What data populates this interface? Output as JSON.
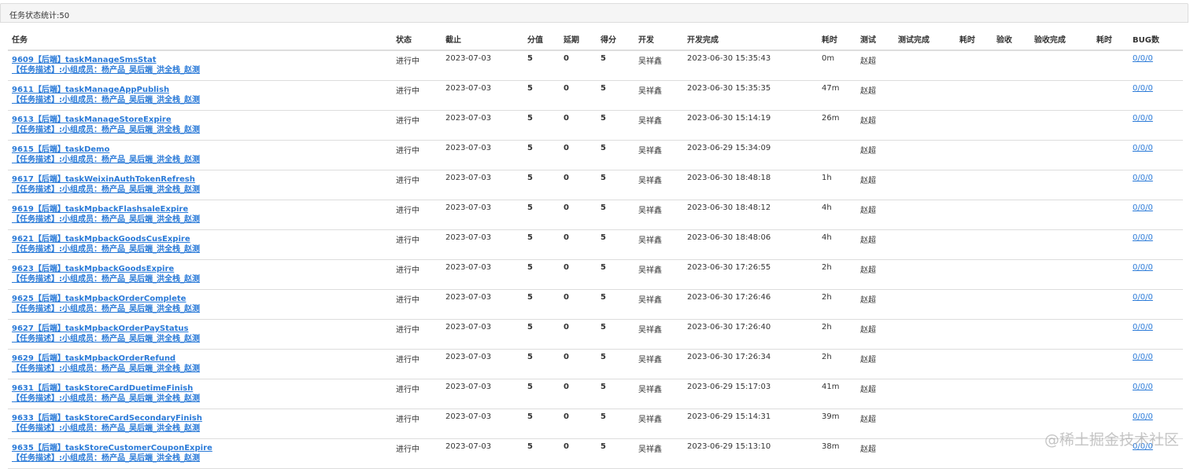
{
  "panel": {
    "title": "任务状态统计:50"
  },
  "table": {
    "headers": [
      "任务",
      "状态",
      "截止",
      "分值",
      "延期",
      "得分",
      "开发",
      "开发完成",
      "耗时",
      "测试",
      "测试完成",
      "耗时",
      "验收",
      "验收完成",
      "耗时",
      "BUG数"
    ],
    "rows": [
      {
        "title": "9609【后端】taskManageSmsStat",
        "desc": "【任务描述】:小组成员：杨产品_吴后端_洪全栈_赵测",
        "status": "进行中",
        "due": "2023-07-03",
        "score": "5",
        "delay": "0",
        "got": "5",
        "dev": "吴祥鑫",
        "dev_done": "2023-06-30 15:35:43",
        "dev_cost": "0m",
        "tester": "赵超",
        "test_done": "",
        "test_cost": "",
        "acceptor": "",
        "accept_done": "",
        "accept_cost": "",
        "bugs": "0/0/0"
      },
      {
        "title": "9611【后端】taskManageAppPublish",
        "desc": "【任务描述】:小组成员：杨产品_吴后端_洪全栈_赵测",
        "status": "进行中",
        "due": "2023-07-03",
        "score": "5",
        "delay": "0",
        "got": "5",
        "dev": "吴祥鑫",
        "dev_done": "2023-06-30 15:35:35",
        "dev_cost": "47m",
        "tester": "赵超",
        "test_done": "",
        "test_cost": "",
        "acceptor": "",
        "accept_done": "",
        "accept_cost": "",
        "bugs": "0/0/0"
      },
      {
        "title": "9613【后端】taskManageStoreExpire",
        "desc": "【任务描述】:小组成员：杨产品_吴后端_洪全栈_赵测",
        "status": "进行中",
        "due": "2023-07-03",
        "score": "5",
        "delay": "0",
        "got": "5",
        "dev": "吴祥鑫",
        "dev_done": "2023-06-30 15:14:19",
        "dev_cost": "26m",
        "tester": "赵超",
        "test_done": "",
        "test_cost": "",
        "acceptor": "",
        "accept_done": "",
        "accept_cost": "",
        "bugs": "0/0/0"
      },
      {
        "title": "9615【后端】taskDemo",
        "desc": "【任务描述】:小组成员：杨产品_吴后端_洪全栈_赵测",
        "status": "进行中",
        "due": "2023-07-03",
        "score": "5",
        "delay": "0",
        "got": "5",
        "dev": "吴祥鑫",
        "dev_done": "2023-06-29 15:34:09",
        "dev_cost": "",
        "tester": "赵超",
        "test_done": "",
        "test_cost": "",
        "acceptor": "",
        "accept_done": "",
        "accept_cost": "",
        "bugs": "0/0/0"
      },
      {
        "title": "9617【后端】taskWeixinAuthTokenRefresh",
        "desc": "【任务描述】:小组成员：杨产品_吴后端_洪全栈_赵测",
        "status": "进行中",
        "due": "2023-07-03",
        "score": "5",
        "delay": "0",
        "got": "5",
        "dev": "吴祥鑫",
        "dev_done": "2023-06-30 18:48:18",
        "dev_cost": "1h",
        "tester": "赵超",
        "test_done": "",
        "test_cost": "",
        "acceptor": "",
        "accept_done": "",
        "accept_cost": "",
        "bugs": "0/0/0"
      },
      {
        "title": "9619【后端】taskMpbackFlashsaleExpire",
        "desc": "【任务描述】:小组成员：杨产品_吴后端_洪全栈_赵测",
        "status": "进行中",
        "due": "2023-07-03",
        "score": "5",
        "delay": "0",
        "got": "5",
        "dev": "吴祥鑫",
        "dev_done": "2023-06-30 18:48:12",
        "dev_cost": "4h",
        "tester": "赵超",
        "test_done": "",
        "test_cost": "",
        "acceptor": "",
        "accept_done": "",
        "accept_cost": "",
        "bugs": "0/0/0"
      },
      {
        "title": "9621【后端】taskMpbackGoodsCusExpire",
        "desc": "【任务描述】:小组成员：杨产品_吴后端_洪全栈_赵测",
        "status": "进行中",
        "due": "2023-07-03",
        "score": "5",
        "delay": "0",
        "got": "5",
        "dev": "吴祥鑫",
        "dev_done": "2023-06-30 18:48:06",
        "dev_cost": "4h",
        "tester": "赵超",
        "test_done": "",
        "test_cost": "",
        "acceptor": "",
        "accept_done": "",
        "accept_cost": "",
        "bugs": "0/0/0"
      },
      {
        "title": "9623【后端】taskMpbackGoodsExpire",
        "desc": "【任务描述】:小组成员：杨产品_吴后端_洪全栈_赵测",
        "status": "进行中",
        "due": "2023-07-03",
        "score": "5",
        "delay": "0",
        "got": "5",
        "dev": "吴祥鑫",
        "dev_done": "2023-06-30 17:26:55",
        "dev_cost": "2h",
        "tester": "赵超",
        "test_done": "",
        "test_cost": "",
        "acceptor": "",
        "accept_done": "",
        "accept_cost": "",
        "bugs": "0/0/0"
      },
      {
        "title": "9625【后端】taskMpbackOrderComplete",
        "desc": "【任务描述】:小组成员：杨产品_吴后端_洪全栈_赵测",
        "status": "进行中",
        "due": "2023-07-03",
        "score": "5",
        "delay": "0",
        "got": "5",
        "dev": "吴祥鑫",
        "dev_done": "2023-06-30 17:26:46",
        "dev_cost": "2h",
        "tester": "赵超",
        "test_done": "",
        "test_cost": "",
        "acceptor": "",
        "accept_done": "",
        "accept_cost": "",
        "bugs": "0/0/0"
      },
      {
        "title": "9627【后端】taskMpbackOrderPayStatus",
        "desc": "【任务描述】:小组成员：杨产品_吴后端_洪全栈_赵测",
        "status": "进行中",
        "due": "2023-07-03",
        "score": "5",
        "delay": "0",
        "got": "5",
        "dev": "吴祥鑫",
        "dev_done": "2023-06-30 17:26:40",
        "dev_cost": "2h",
        "tester": "赵超",
        "test_done": "",
        "test_cost": "",
        "acceptor": "",
        "accept_done": "",
        "accept_cost": "",
        "bugs": "0/0/0"
      },
      {
        "title": "9629【后端】taskMpbackOrderRefund",
        "desc": "【任务描述】:小组成员：杨产品_吴后端_洪全栈_赵测",
        "status": "进行中",
        "due": "2023-07-03",
        "score": "5",
        "delay": "0",
        "got": "5",
        "dev": "吴祥鑫",
        "dev_done": "2023-06-30 17:26:34",
        "dev_cost": "2h",
        "tester": "赵超",
        "test_done": "",
        "test_cost": "",
        "acceptor": "",
        "accept_done": "",
        "accept_cost": "",
        "bugs": "0/0/0"
      },
      {
        "title": "9631【后端】taskStoreCardDuetimeFinish",
        "desc": "【任务描述】:小组成员：杨产品_吴后端_洪全栈_赵测",
        "status": "进行中",
        "due": "2023-07-03",
        "score": "5",
        "delay": "0",
        "got": "5",
        "dev": "吴祥鑫",
        "dev_done": "2023-06-29 15:17:03",
        "dev_cost": "41m",
        "tester": "赵超",
        "test_done": "",
        "test_cost": "",
        "acceptor": "",
        "accept_done": "",
        "accept_cost": "",
        "bugs": "0/0/0"
      },
      {
        "title": "9633【后端】taskStoreCardSecondaryFinish",
        "desc": "【任务描述】:小组成员：杨产品_吴后端_洪全栈_赵测",
        "status": "进行中",
        "due": "2023-07-03",
        "score": "5",
        "delay": "0",
        "got": "5",
        "dev": "吴祥鑫",
        "dev_done": "2023-06-29 15:14:31",
        "dev_cost": "39m",
        "tester": "赵超",
        "test_done": "",
        "test_cost": "",
        "acceptor": "",
        "accept_done": "",
        "accept_cost": "",
        "bugs": "0/0/0"
      },
      {
        "title": "9635【后端】taskStoreCustomerCouponExpire",
        "desc": "【任务描述】:小组成员：杨产品_吴后端_洪全栈_赵测",
        "status": "进行中",
        "due": "2023-07-03",
        "score": "5",
        "delay": "0",
        "got": "5",
        "dev": "吴祥鑫",
        "dev_done": "2023-06-29 15:13:10",
        "dev_cost": "38m",
        "tester": "赵超",
        "test_done": "",
        "test_cost": "",
        "acceptor": "",
        "accept_done": "",
        "accept_cost": "",
        "bugs": "0/0/0"
      }
    ]
  },
  "watermark": "@稀土掘金技术社区"
}
